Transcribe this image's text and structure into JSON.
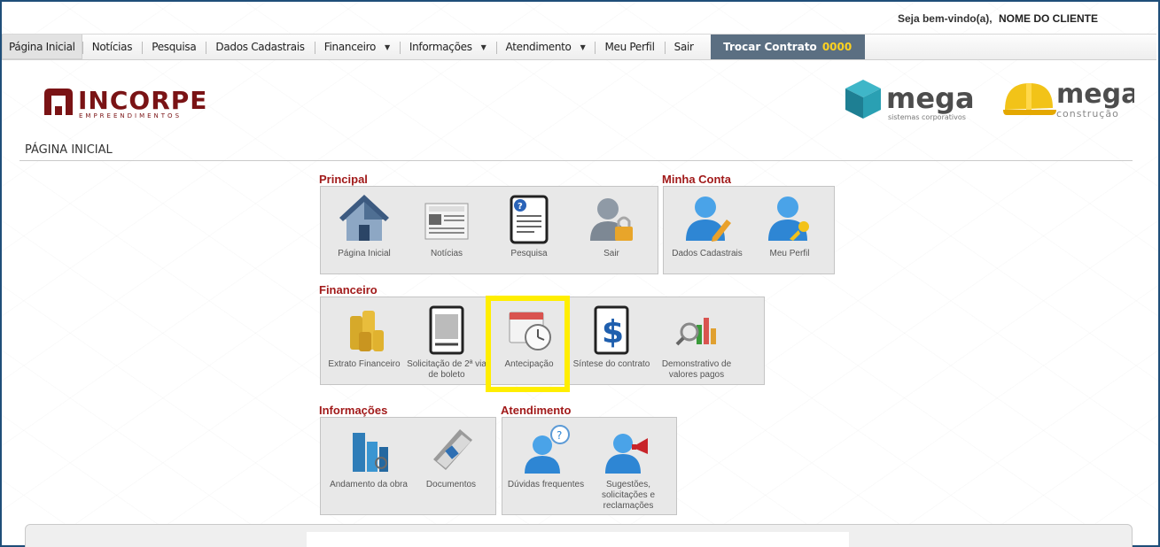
{
  "welcome": {
    "label": "Seja bem-vindo(a),",
    "name": "NOME DO CLIENTE"
  },
  "nav": {
    "items": [
      {
        "label": "Página Inicial",
        "dropdown": false,
        "active": true
      },
      {
        "label": "Notícias",
        "dropdown": false
      },
      {
        "label": "Pesquisa",
        "dropdown": false
      },
      {
        "label": "Dados Cadastrais",
        "dropdown": false
      },
      {
        "label": "Financeiro",
        "dropdown": true
      },
      {
        "label": "Informações",
        "dropdown": true
      },
      {
        "label": "Atendimento",
        "dropdown": true
      },
      {
        "label": "Meu Perfil",
        "dropdown": false
      },
      {
        "label": "Sair",
        "dropdown": false
      }
    ],
    "trocar_label": "Trocar Contrato",
    "trocar_number": "0000"
  },
  "logos": {
    "incorpe_main": "INCORPE",
    "incorpe_sub": "EMPREENDIMENTOS",
    "mega1_main": "mega",
    "mega1_sub": "sistemas corporativos",
    "mega2_main": "mega",
    "mega2_sub": "construção"
  },
  "page_title": "PÁGINA INICIAL",
  "sections": {
    "principal": {
      "title": "Principal",
      "tiles": [
        {
          "label": "Página Inicial",
          "icon": "house-icon"
        },
        {
          "label": "Notícias",
          "icon": "newspaper-icon"
        },
        {
          "label": "Pesquisa",
          "icon": "survey-document-icon"
        },
        {
          "label": "Sair",
          "icon": "user-lock-icon"
        }
      ]
    },
    "minha_conta": {
      "title": "Minha Conta",
      "tiles": [
        {
          "label": "Dados Cadastrais",
          "icon": "user-edit-icon"
        },
        {
          "label": "Meu Perfil",
          "icon": "user-key-icon"
        }
      ]
    },
    "financeiro": {
      "title": "Financeiro",
      "tiles": [
        {
          "label": "Extrato Financeiro",
          "icon": "coins-icon"
        },
        {
          "label": "Solicitação de 2ª via de boleto",
          "icon": "invoice-icon"
        },
        {
          "label": "Antecipação",
          "icon": "calendar-clock-icon"
        },
        {
          "label": "Síntese do contrato",
          "icon": "dollar-document-icon"
        },
        {
          "label": "Demonstrativo de valores pagos",
          "icon": "chart-magnifier-icon"
        }
      ]
    },
    "informacoes": {
      "title": "Informações",
      "tiles": [
        {
          "label": "Andamento da obra",
          "icon": "buildings-icon"
        },
        {
          "label": "Documentos",
          "icon": "documents-icon"
        }
      ]
    },
    "atendimento": {
      "title": "Atendimento",
      "tiles": [
        {
          "label": "Dúvidas frequentes",
          "icon": "user-question-icon"
        },
        {
          "label": "Sugestões, solicitações e reclamações",
          "icon": "user-megaphone-icon"
        }
      ]
    }
  },
  "colors": {
    "section_title": "#a11a1a",
    "trocar_bg": "#5b6f82",
    "trocar_number": "#ffd21f",
    "highlight": "#ffee00",
    "frame": "#1f4e79"
  }
}
